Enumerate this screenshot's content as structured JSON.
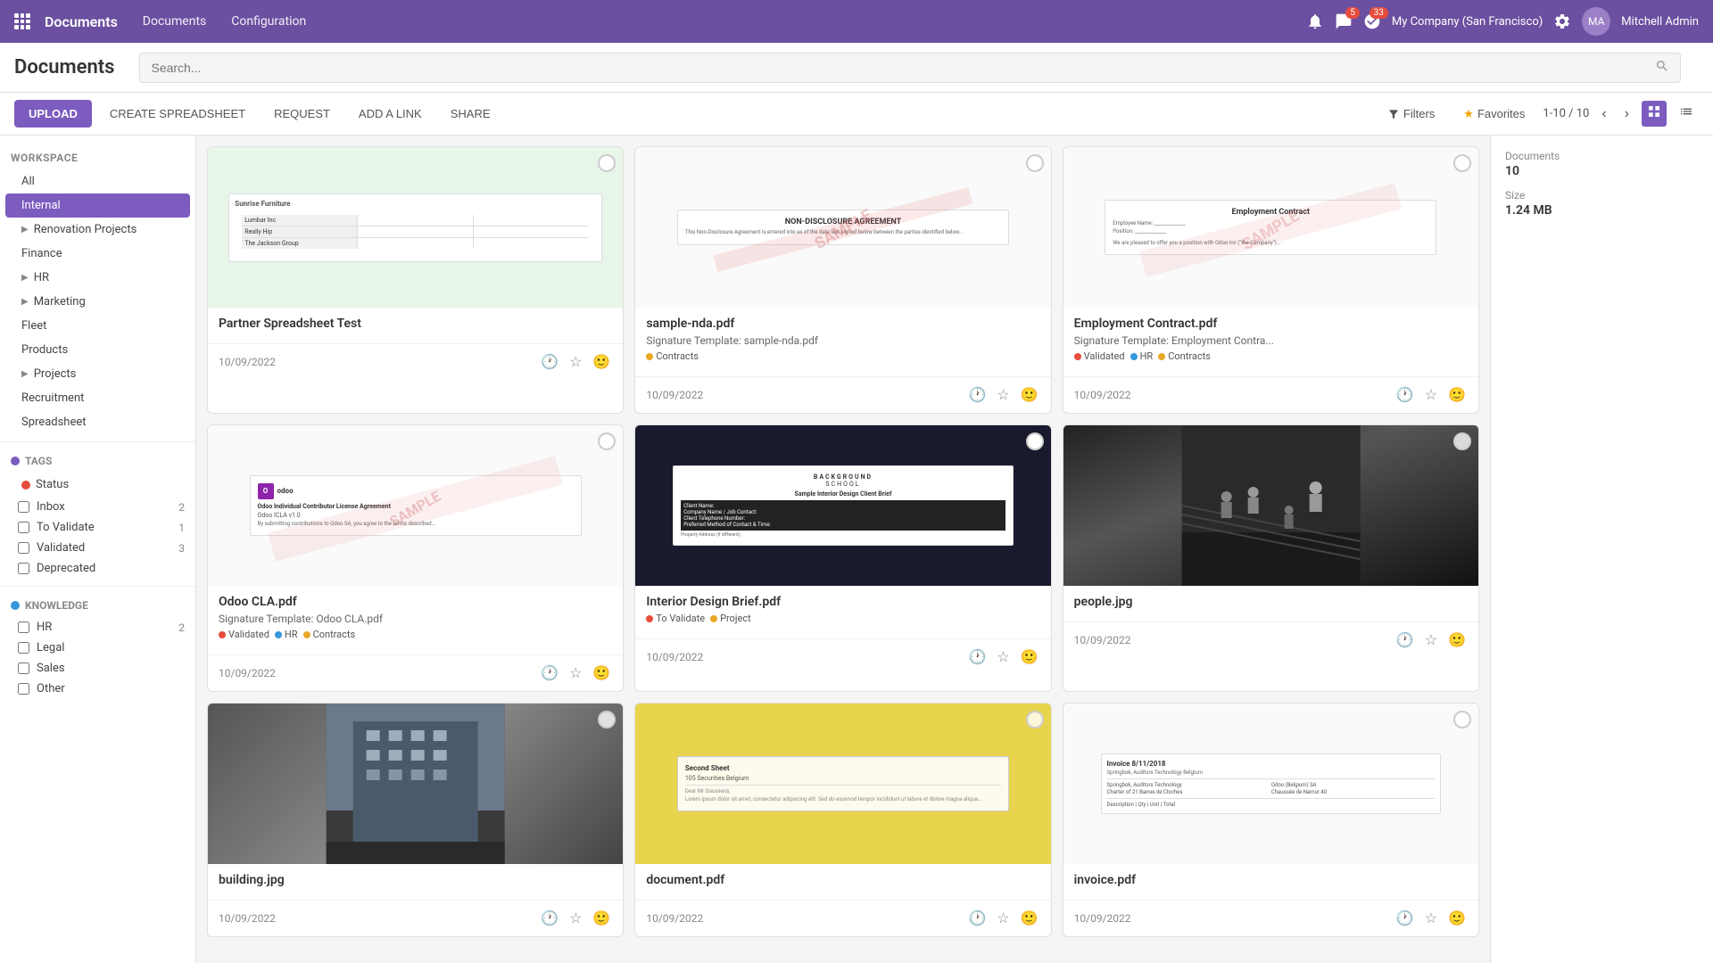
{
  "app": {
    "grid_label": "Apps",
    "title": "Documents",
    "nav_links": [
      "Documents",
      "Configuration"
    ]
  },
  "topbar": {
    "notification_icon": "🔔",
    "chat_count": "5",
    "activity_count": "33",
    "company": "My Company (San Francisco)",
    "settings_icon": "⚙",
    "user_name": "Mitchell Admin"
  },
  "header": {
    "page_title": "Documents",
    "search_placeholder": "Search..."
  },
  "toolbar": {
    "upload_label": "UPLOAD",
    "create_spreadsheet_label": "CREATE SPREADSHEET",
    "request_label": "REQUEST",
    "add_link_label": "ADD A LINK",
    "share_label": "SHARE",
    "filters_label": "Filters",
    "favorites_label": "Favorites",
    "pagination": "1-10 / 10"
  },
  "sidebar": {
    "workspace_label": "WORKSPACE",
    "items": [
      {
        "label": "All",
        "indent": false,
        "active": false
      },
      {
        "label": "Internal",
        "indent": false,
        "active": true
      },
      {
        "label": "Renovation Projects",
        "indent": false,
        "active": false,
        "has_arrow": true
      },
      {
        "label": "Finance",
        "indent": false,
        "active": false
      },
      {
        "label": "HR",
        "indent": false,
        "active": false,
        "has_arrow": true
      },
      {
        "label": "Marketing",
        "indent": false,
        "active": false,
        "has_arrow": true
      },
      {
        "label": "Fleet",
        "indent": false,
        "active": false
      },
      {
        "label": "Products",
        "indent": false,
        "active": false
      },
      {
        "label": "Projects",
        "indent": false,
        "active": false,
        "has_arrow": true
      },
      {
        "label": "Recruitment",
        "indent": false,
        "active": false
      },
      {
        "label": "Spreadsheet",
        "indent": false,
        "active": false
      }
    ],
    "tags_label": "TAGS",
    "tags_dot_color": "purple",
    "status_label": "Status",
    "status_dot": "red",
    "tag_items": [
      {
        "label": "Inbox",
        "count": "2"
      },
      {
        "label": "To Validate",
        "count": "1"
      },
      {
        "label": "Validated",
        "count": "3"
      },
      {
        "label": "Deprecated",
        "count": ""
      }
    ],
    "knowledge_label": "Knowledge",
    "knowledge_dot": "blue",
    "knowledge_items": [
      {
        "label": "HR",
        "count": "2"
      },
      {
        "label": "Legal",
        "count": ""
      },
      {
        "label": "Sales",
        "count": ""
      },
      {
        "label": "Other",
        "count": ""
      }
    ]
  },
  "documents": [
    {
      "id": 1,
      "title": "Partner Spreadsheet Test",
      "subtitle": "",
      "date": "10/09/2022",
      "tags": [],
      "thumb_type": "spreadsheet"
    },
    {
      "id": 2,
      "title": "sample-nda.pdf",
      "subtitle": "Signature Template: sample-nda.pdf",
      "date": "10/09/2022",
      "tags": [
        {
          "label": "Contracts",
          "color": "#e8a825"
        }
      ],
      "thumb_type": "pdf_nda"
    },
    {
      "id": 3,
      "title": "Employment Contract.pdf",
      "subtitle": "Signature Template: Employment Contra...",
      "date": "10/09/2022",
      "tags": [
        {
          "label": "Validated",
          "color": "#e74c3c"
        },
        {
          "label": "HR",
          "color": "#3498db"
        },
        {
          "label": "Contracts",
          "color": "#e8a825"
        }
      ],
      "thumb_type": "pdf_contract"
    },
    {
      "id": 4,
      "title": "Odoo CLA.pdf",
      "subtitle": "Signature Template: Odoo CLA.pdf",
      "date": "10/09/2022",
      "tags": [
        {
          "label": "Validated",
          "color": "#e74c3c"
        },
        {
          "label": "HR",
          "color": "#3498db"
        },
        {
          "label": "Contracts",
          "color": "#e8a825"
        }
      ],
      "thumb_type": "pdf_cla"
    },
    {
      "id": 5,
      "title": "Interior Design Brief.pdf",
      "subtitle": "",
      "date": "10/09/2022",
      "tags": [
        {
          "label": "To Validate",
          "color": "#e74c3c"
        },
        {
          "label": "Project",
          "color": "#e8a825"
        }
      ],
      "thumb_type": "pdf_interior"
    },
    {
      "id": 6,
      "title": "people.jpg",
      "subtitle": "",
      "date": "10/09/2022",
      "tags": [],
      "thumb_type": "img_people"
    },
    {
      "id": 7,
      "title": "building.jpg",
      "subtitle": "",
      "date": "10/09/2022",
      "tags": [],
      "thumb_type": "img_building"
    },
    {
      "id": 8,
      "title": "document.pdf",
      "subtitle": "",
      "date": "10/09/2022",
      "tags": [],
      "thumb_type": "pdf_yellow"
    },
    {
      "id": 9,
      "title": "invoice.pdf",
      "subtitle": "",
      "date": "10/09/2022",
      "tags": [],
      "thumb_type": "pdf_invoice"
    }
  ],
  "right_panel": {
    "documents_label": "Documents",
    "documents_value": "10",
    "size_label": "Size",
    "size_value": "1.24 MB"
  }
}
